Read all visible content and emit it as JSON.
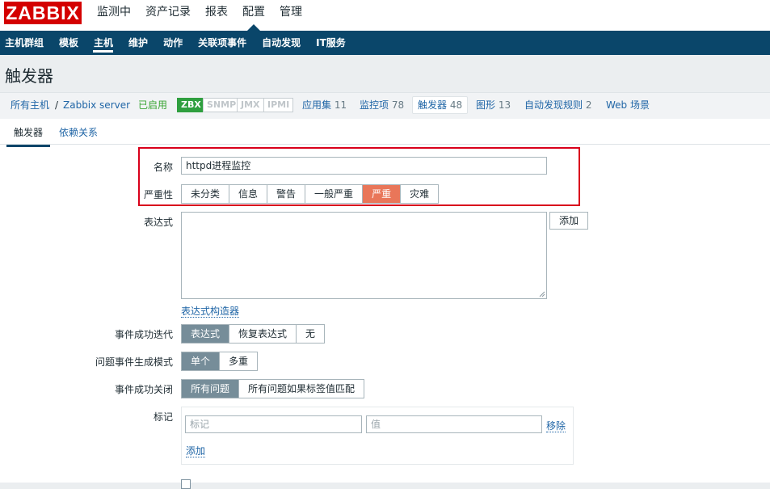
{
  "app": {
    "logo": "ZABBIX"
  },
  "top_menu": [
    {
      "label": "监测中",
      "active": false
    },
    {
      "label": "资产记录",
      "active": false
    },
    {
      "label": "报表",
      "active": false
    },
    {
      "label": "配置",
      "active": true
    },
    {
      "label": "管理",
      "active": false
    }
  ],
  "sub_menu": [
    {
      "label": "主机群组",
      "active": false
    },
    {
      "label": "模板",
      "active": false
    },
    {
      "label": "主机",
      "active": true
    },
    {
      "label": "维护",
      "active": false
    },
    {
      "label": "动作",
      "active": false
    },
    {
      "label": "关联项事件",
      "active": false
    },
    {
      "label": "自动发现",
      "active": false
    },
    {
      "label": "IT服务",
      "active": false
    }
  ],
  "page_title": "触发器",
  "breadcrumb": {
    "all_hosts": "所有主机",
    "separator": "/",
    "host": "Zabbix server",
    "status": "已启用",
    "availability": [
      "ZBX",
      "SNMP",
      "JMX",
      "IPMI"
    ],
    "links": [
      {
        "label": "应用集",
        "count": "11"
      },
      {
        "label": "监控项",
        "count": "78"
      },
      {
        "label": "触发器",
        "count": "48"
      },
      {
        "label": "图形",
        "count": "13"
      },
      {
        "label": "自动发现规则",
        "count": "2"
      },
      {
        "label": "Web 场景",
        "count": ""
      }
    ]
  },
  "form_tabs": {
    "trigger": "触发器",
    "dependencies": "依赖关系"
  },
  "form": {
    "name_label": "名称",
    "name_value": "httpd进程监控",
    "severity_label": "严重性",
    "severity_options": [
      "未分类",
      "信息",
      "警告",
      "一般严重",
      "严重",
      "灾难"
    ],
    "severity_selected": "严重",
    "expression_label": "表达式",
    "add_button": "添加",
    "expression_builder": "表达式构造器",
    "ok_event_gen_label": "事件成功迭代",
    "ok_event_gen_options": [
      "表达式",
      "恢复表达式",
      "无"
    ],
    "ok_event_gen_selected": "表达式",
    "problem_mode_label": "问题事件生成模式",
    "problem_mode_options": [
      "单个",
      "多重"
    ],
    "problem_mode_selected": "单个",
    "ok_close_label": "事件成功关闭",
    "ok_close_options": [
      "所有问题",
      "所有问题如果标签值匹配"
    ],
    "ok_close_selected": "所有问题",
    "tags_label": "标记",
    "tag_placeholder": "标记",
    "value_placeholder": "值",
    "remove_link": "移除",
    "add_link": "添加"
  },
  "colors": {
    "brand": "#d40000",
    "nav": "#0a466a",
    "severity_high": "#e97659",
    "selected_segment": "#768d99",
    "highlight_box": "#d9001b",
    "enabled_status": "#3aa534"
  }
}
